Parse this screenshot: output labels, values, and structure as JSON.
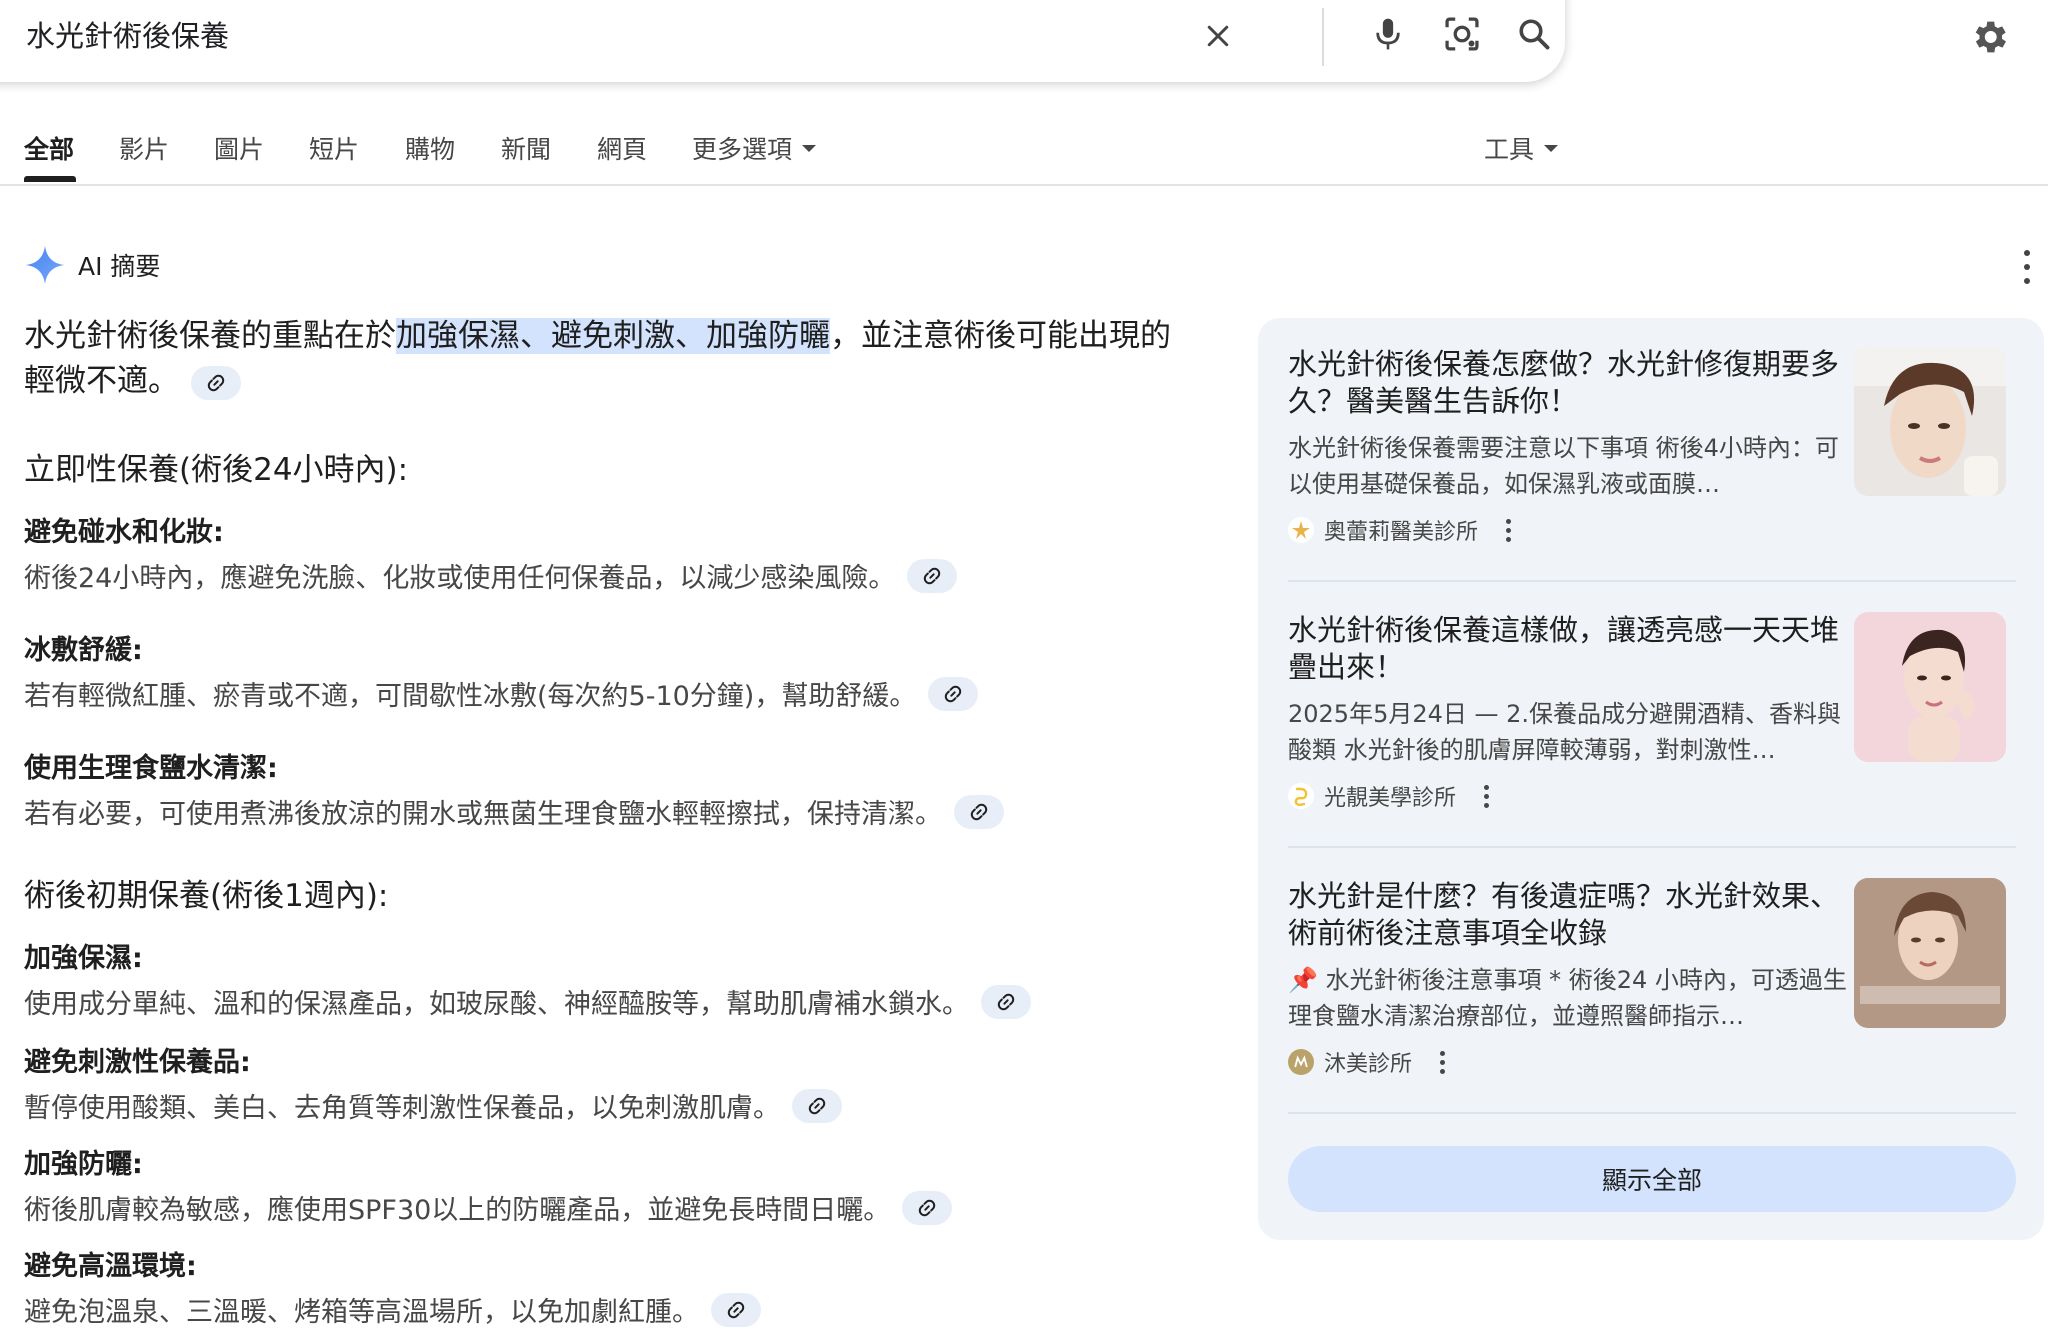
{
  "search": {
    "query": "水光針術後保養",
    "icons": [
      "close-icon",
      "mic-icon",
      "lens-icon",
      "search-icon"
    ]
  },
  "settings_icon": "gear-icon",
  "tabs": [
    {
      "label": "全部",
      "active": true
    },
    {
      "label": "影片"
    },
    {
      "label": "圖片"
    },
    {
      "label": "短片"
    },
    {
      "label": "購物"
    },
    {
      "label": "新聞"
    },
    {
      "label": "網頁"
    },
    {
      "label": "更多選項",
      "dropdown": true
    }
  ],
  "tools_label": "工具",
  "ai_overview": {
    "label": "AI 摘要",
    "intro_pre": "水光針術後保養的重點在於",
    "intro_highlight": "加強保濕、避免刺激、加強防曬",
    "intro_post": "，並注意術後可能出現的輕微不適。",
    "sections": [
      {
        "heading": "立即性保養(術後24小時內):",
        "items": [
          {
            "title": "避免碰水和化妝:",
            "text": "術後24小時內，應避免洗臉、化妝或使用任何保養品，以減少感染風險。"
          },
          {
            "title": "冰敷舒緩:",
            "text": "若有輕微紅腫、瘀青或不適，可間歇性冰敷(每次約5-10分鐘)，幫助舒緩。"
          },
          {
            "title": "使用生理食鹽水清潔:",
            "text": "若有必要，可使用煮沸後放涼的開水或無菌生理食鹽水輕輕擦拭，保持清潔。"
          }
        ]
      },
      {
        "heading": "術後初期保養(術後1週內):",
        "items": [
          {
            "title": "加強保濕:",
            "text": "使用成分單純、溫和的保濕產品，如玻尿酸、神經醯胺等，幫助肌膚補水鎖水。"
          },
          {
            "title": "避免刺激性保養品:",
            "text": "暫停使用酸類、美白、去角質等刺激性保養品，以免刺激肌膚。"
          },
          {
            "title": "加強防曬:",
            "text": "術後肌膚較為敏感，應使用SPF30以上的防曬產品，並避免長時間日曬。"
          },
          {
            "title": "避免高溫環境:",
            "text": "避免泡溫泉、三溫暖、烤箱等高溫場所，以免加劇紅腫。"
          }
        ]
      }
    ]
  },
  "sources": {
    "cards": [
      {
        "title": "水光針術後保養怎麼做？水光針修復期要多久？醫美醫生告訴你！",
        "snippet": "水光針術後保養需要注意以下事項 術後4小時內：可以使用基礎保養品，如保濕乳液或面膜…",
        "source": "奧蕾莉醫美診所",
        "favicon_color": "#e8b34a"
      },
      {
        "title": "水光針術後保養這樣做，讓透亮感一天天堆疊出來！",
        "snippet": "2025年5月24日 — 2.保養品成分避開酒精、香料與酸類 水光針後的肌膚屏障較薄弱，對刺激性…",
        "source": "光靚美學診所",
        "favicon_color": "#f2c230"
      },
      {
        "title": "水光針是什麼？有後遺症嗎？水光針效果、術前術後注意事項全收錄",
        "snippet": "📌 水光針術後注意事項 * 術後24 小時內，可透過生理食鹽水清潔治療部位，並遵照醫師指示…",
        "source": "沐美診所",
        "favicon_color": "#b9a36a"
      }
    ],
    "show_all_label": "顯示全部"
  },
  "colors": {
    "accent": "#4285f4",
    "highlight": "#d3e3fd",
    "panel_bg": "#f0f4f9"
  }
}
